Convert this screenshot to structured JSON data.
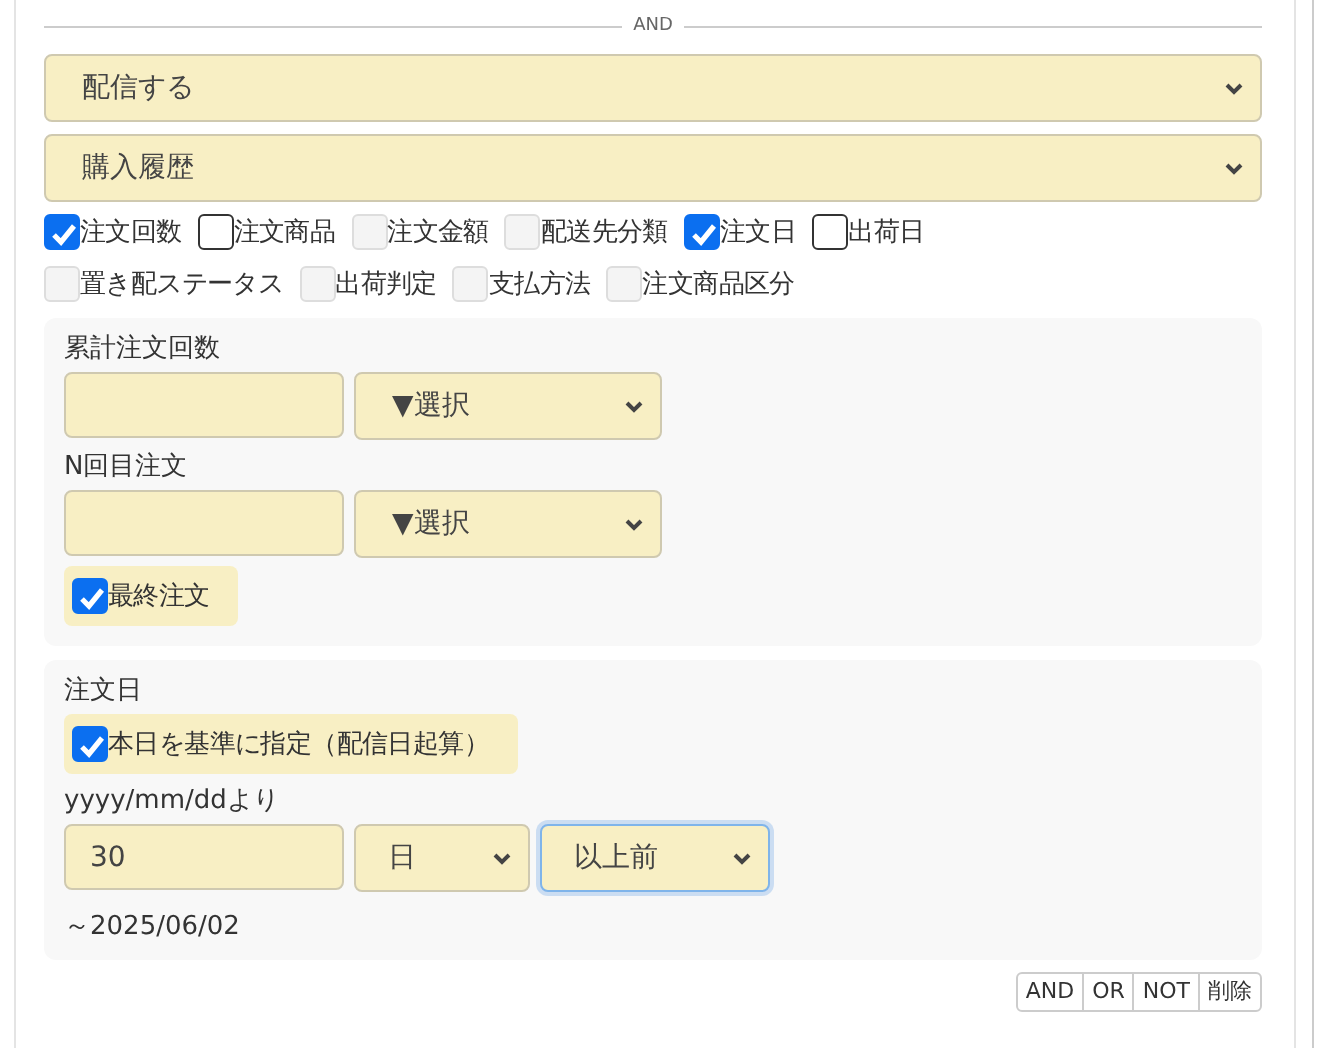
{
  "divider": {
    "label": "AND"
  },
  "selects": [
    {
      "value": "配信する"
    },
    {
      "value": "購入履歴"
    }
  ],
  "filters": [
    {
      "label": "注文回数",
      "checked": true,
      "disabled": false
    },
    {
      "label": "注文商品",
      "checked": false,
      "disabled": false
    },
    {
      "label": "注文金額",
      "checked": false,
      "disabled": true
    },
    {
      "label": "配送先分類",
      "checked": false,
      "disabled": true
    },
    {
      "label": "注文日",
      "checked": true,
      "disabled": false
    },
    {
      "label": "出荷日",
      "checked": false,
      "disabled": false
    },
    {
      "label": "置き配ステータス",
      "checked": false,
      "disabled": true
    },
    {
      "label": "出荷判定",
      "checked": false,
      "disabled": true
    },
    {
      "label": "支払方法",
      "checked": false,
      "disabled": true
    },
    {
      "label": "注文商品区分",
      "checked": false,
      "disabled": true
    }
  ],
  "panels": [
    {
      "items": [
        {
          "kind": "label",
          "text": "累計注文回数"
        },
        {
          "kind": "inputs",
          "controls": [
            {
              "kind": "text"
            },
            {
              "kind": "select",
              "value": "▼選択",
              "focused": false
            }
          ]
        },
        {
          "kind": "label",
          "text": "N回目注文"
        },
        {
          "kind": "inputs",
          "controls": [
            {
              "kind": "text"
            },
            {
              "kind": "select",
              "value": "▼選択",
              "focused": false
            }
          ]
        },
        {
          "kind": "check",
          "label": "最終注文",
          "checked": true
        }
      ]
    },
    {
      "items": [
        {
          "kind": "label",
          "text": "注文日"
        },
        {
          "kind": "check",
          "label": "本日を基準に指定（配信日起算）",
          "checked": true
        },
        {
          "kind": "label",
          "text": "yyyy/mm/ddより"
        },
        {
          "kind": "inputs",
          "controls": [
            {
              "kind": "text",
              "value": "30"
            },
            {
              "kind": "select",
              "value": "日",
              "focused": false
            },
            {
              "kind": "select",
              "value": "以上前",
              "focused": true
            }
          ]
        },
        {
          "kind": "note",
          "text": "～2025/06/02"
        }
      ]
    }
  ],
  "buttons": [
    "AND",
    "OR",
    "NOT",
    "削除"
  ]
}
